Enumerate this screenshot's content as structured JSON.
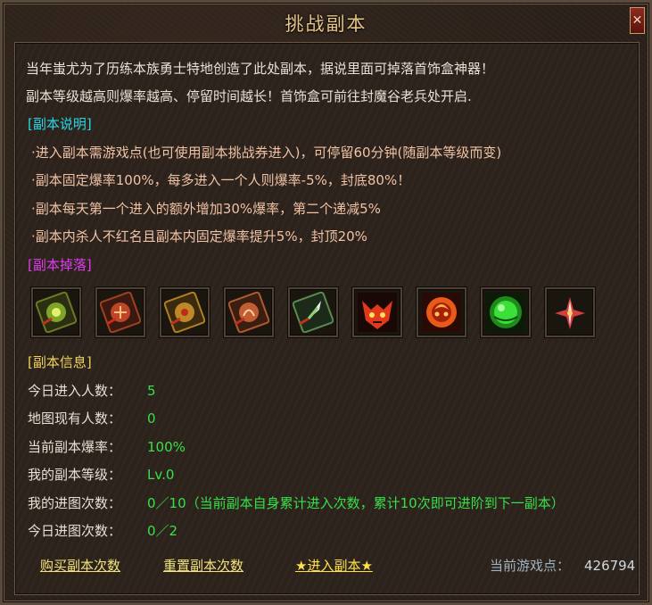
{
  "window": {
    "title": "挑战副本",
    "close_label": "✕"
  },
  "intro": [
    "当年蚩尤为了历练本族勇士特地创造了此处副本，据说里面可掉落首饰盒神器！",
    "副本等级越高则爆率越高、停留时间越长！首饰盒可前往封魔谷老兵处开启."
  ],
  "description": {
    "header": "[副本说明]",
    "rules": [
      "·进入副本需游戏点(也可使用副本挑战券进入)，可停留60分钟(随副本等级而变)",
      "·副本固定爆率100%，每多进入一个人则爆率-5%，封底80%！",
      "·副本每天第一个进入的额外增加30%爆率，第二个递减5%",
      "·副本内杀人不红名且副本内固定爆率提升5%，封顶20%"
    ]
  },
  "drops": {
    "header": "[副本掉落]",
    "items": [
      {
        "icon": "green-rune-scroll-icon",
        "color": "#9acd32"
      },
      {
        "icon": "red-rune-scroll-icon",
        "color": "#e0502a"
      },
      {
        "icon": "gold-rune-scroll-icon",
        "color": "#e0a030"
      },
      {
        "icon": "orange-rune-scroll-icon",
        "color": "#d86a3a"
      },
      {
        "icon": "green-blade-scroll-icon",
        "color": "#8fd07a"
      },
      {
        "icon": "demon-face-icon",
        "color": "#e03a1a"
      },
      {
        "icon": "flame-demon-icon",
        "color": "#e85a1a"
      },
      {
        "icon": "green-orb-icon",
        "color": "#3adf3a"
      },
      {
        "icon": "winged-dart-icon",
        "color": "#d04040"
      }
    ]
  },
  "info": {
    "header": "[副本信息]",
    "rows": [
      {
        "label": "今日进入人数：",
        "value": "5"
      },
      {
        "label": "地图现有人数：",
        "value": "0"
      },
      {
        "label": "当前副本爆率：",
        "value": "100%"
      },
      {
        "label": "我的副本等级：",
        "value": "Lv.0"
      },
      {
        "label": "我的进图次数：",
        "value": "0／10（当前副本自身累计进入次数，累计10次即可进阶到下一副本）"
      },
      {
        "label": "今日进图次数：",
        "value": "0／2"
      }
    ]
  },
  "actions": {
    "buy": "购买副本次数",
    "reset": "重置副本次数",
    "enter": "★进入副本★",
    "points_label": "当前游戏点：",
    "points_value": "426794"
  }
}
